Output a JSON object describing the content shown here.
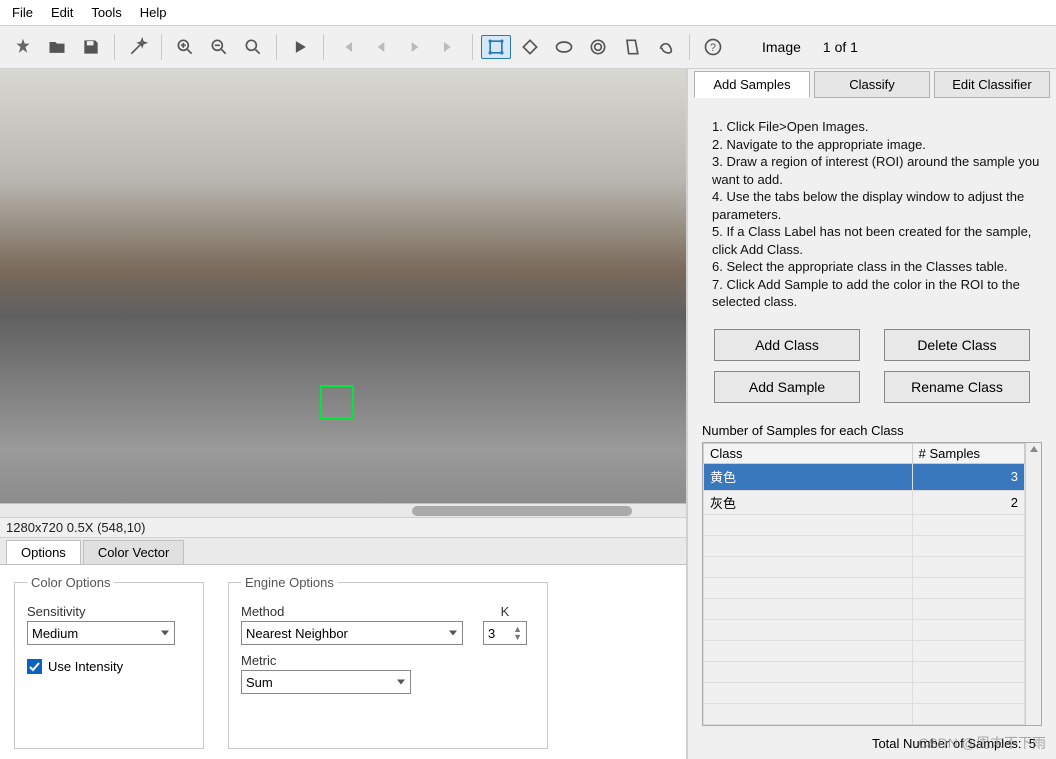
{
  "menu": {
    "file": "File",
    "edit": "Edit",
    "tools": "Tools",
    "help": "Help"
  },
  "toolbar": {
    "image_label": "Image",
    "counter": "1 of 1"
  },
  "viewer": {
    "status": "1280x720 0.5X   (548,10)"
  },
  "options_tabs": {
    "options": "Options",
    "color_vector": "Color Vector"
  },
  "color_options": {
    "legend": "Color Options",
    "sensitivity_label": "Sensitivity",
    "sensitivity_value": "Medium",
    "use_intensity": "Use Intensity"
  },
  "engine_options": {
    "legend": "Engine Options",
    "method_label": "Method",
    "method_value": "Nearest Neighbor",
    "k_label": "K",
    "k_value": "3",
    "metric_label": "Metric",
    "metric_value": "Sum"
  },
  "right_tabs": {
    "add_samples": "Add Samples",
    "classify": "Classify",
    "edit_classifier": "Edit Classifier"
  },
  "instructions": [
    "1. Click File>Open Images.",
    "2. Navigate to the appropriate image.",
    "3. Draw a region of interest (ROI) around the sample you want to add.",
    "4. Use the tabs below the display window to adjust the parameters.",
    "5. If a Class Label has not been created for the sample, click Add Class.",
    "6. Select the appropriate class in the Classes table.",
    "7. Click Add Sample to add the color in the ROI to the selected class."
  ],
  "buttons": {
    "add_class": "Add Class",
    "delete_class": "Delete Class",
    "add_sample": "Add Sample",
    "rename_class": "Rename Class"
  },
  "table": {
    "label": "Number of Samples for each Class",
    "col_class": "Class",
    "col_samples": "# Samples",
    "rows": [
      {
        "class": "黄色",
        "samples": "3",
        "selected": true
      },
      {
        "class": "灰色",
        "samples": "2",
        "selected": false
      }
    ],
    "total_label": "Total Number of Samples:",
    "total_value": "5"
  },
  "watermark": "CSDN @周末不下雨"
}
